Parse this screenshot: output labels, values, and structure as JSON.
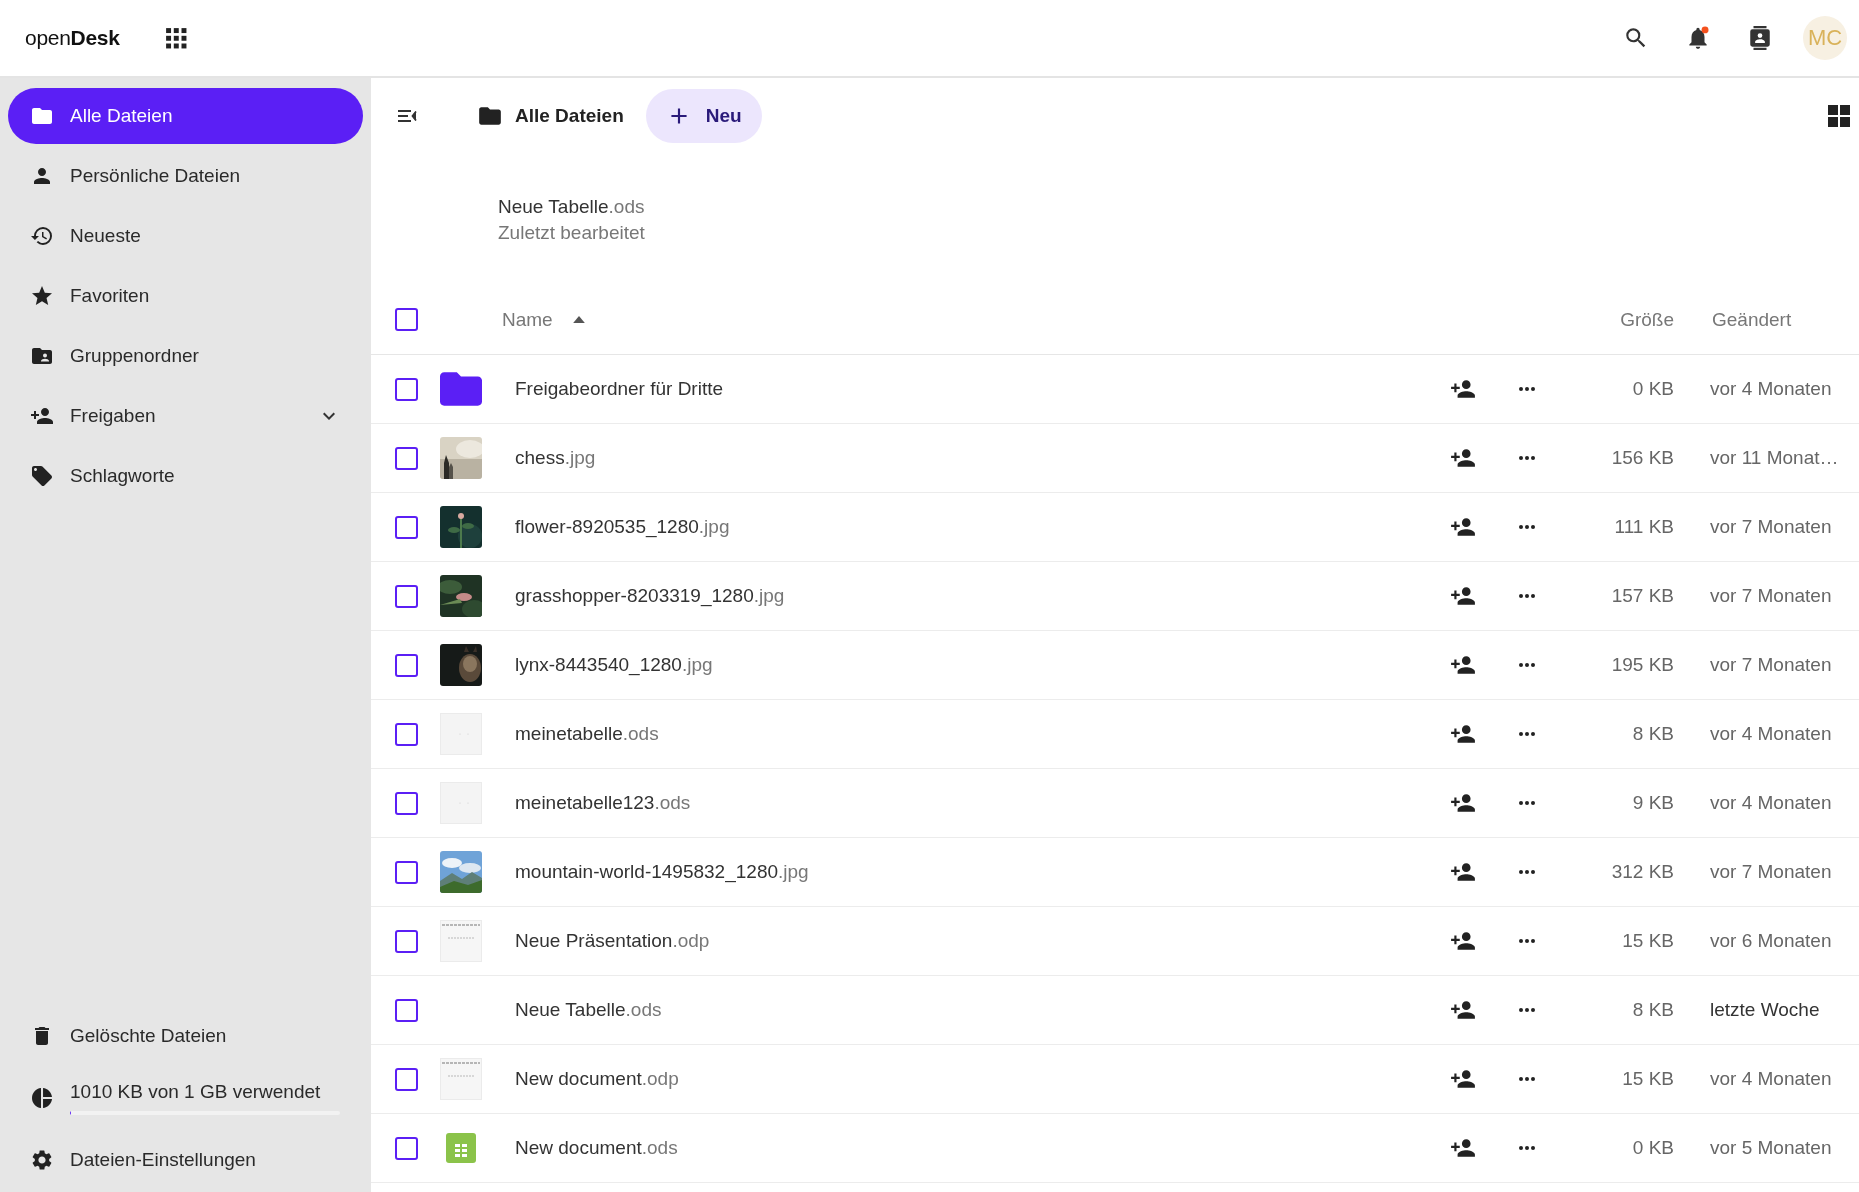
{
  "header": {
    "logo": "open**Desk**",
    "notifications": {
      "unread": true
    },
    "avatar": {
      "initials": "MC"
    }
  },
  "sidebar": {
    "items": [
      {
        "label": "Alle Dateien",
        "selected": true
      },
      {
        "label": "Persönliche Dateien",
        "selected": false
      },
      {
        "label": "Neueste",
        "selected": false
      },
      {
        "label": "Favoriten",
        "selected": false
      },
      {
        "label": "Gruppenordner",
        "selected": false
      },
      {
        "label": "Freigaben",
        "selected": false,
        "expanded": false
      },
      {
        "label": "Schlagworte",
        "selected": false
      }
    ],
    "trash": "Gelöschte Dateien",
    "storage": {
      "label": "1010 KB von 1 GB verwendet",
      "level": 0.001
    },
    "settings": "Dateien-Einstellungen"
  },
  "toolbar": {
    "breadcrumb": "Alle Dateien",
    "new_button": "Neu"
  },
  "recent": {
    "name": "Neue Tabelle.ods",
    "caption": "Zuletzt bearbeitet"
  },
  "table": {
    "select_all": {
      "checked": false
    },
    "columns": [
      {
        "label": "Name",
        "sort_ascending": true
      },
      {
        "label": "Größe"
      },
      {
        "label": "Geändert"
      }
    ],
    "rows": [
      {
        "kind": "folder",
        "name": "Freigabeordner für Dritte",
        "size": "0 KB",
        "modified": "vor 4 Monaten",
        "recent": false,
        "checked": false
      },
      {
        "kind": "picture",
        "name": "chess.jpg",
        "size": "156 KB",
        "modified": "vor 11 Monat…",
        "recent": false,
        "checked": false
      },
      {
        "kind": "picture",
        "name": "flower-8920535_1280.jpg",
        "size": "111 KB",
        "modified": "vor 7 Monaten",
        "recent": false,
        "checked": false
      },
      {
        "kind": "picture",
        "name": "grasshopper-8203319_1280.jpg",
        "size": "157 KB",
        "modified": "vor 7 Monaten",
        "recent": false,
        "checked": false
      },
      {
        "kind": "picture",
        "name": "lynx-8443540_1280.jpg",
        "size": "195 KB",
        "modified": "vor 7 Monaten",
        "recent": false,
        "checked": false
      },
      {
        "kind": "blank",
        "name": "meinetabelle.ods",
        "size": "8 KB",
        "modified": "vor 4 Monaten",
        "recent": false,
        "checked": false
      },
      {
        "kind": "blank",
        "name": "meinetabelle123.ods",
        "size": "9 KB",
        "modified": "vor 4 Monaten",
        "recent": false,
        "checked": false
      },
      {
        "kind": "picture",
        "name": "mountain-world-1495832_1280.jpg",
        "size": "312 KB",
        "modified": "vor 7 Monaten",
        "recent": false,
        "checked": false
      },
      {
        "kind": "slides",
        "name": "Neue Präsentation.odp",
        "size": "15 KB",
        "modified": "vor 6 Monaten",
        "recent": false,
        "checked": false
      },
      {
        "kind": "none",
        "name": "Neue Tabelle.ods",
        "size": "8 KB",
        "modified": "letzte Woche",
        "recent": true,
        "checked": false
      },
      {
        "kind": "slides",
        "name": "New document.odp",
        "size": "15 KB",
        "modified": "vor 4 Monaten",
        "recent": false,
        "checked": false
      },
      {
        "kind": "sheet",
        "name": "New document.ods",
        "size": "0 KB",
        "modified": "vor 5 Monaten",
        "recent": false,
        "checked": false
      }
    ]
  }
}
